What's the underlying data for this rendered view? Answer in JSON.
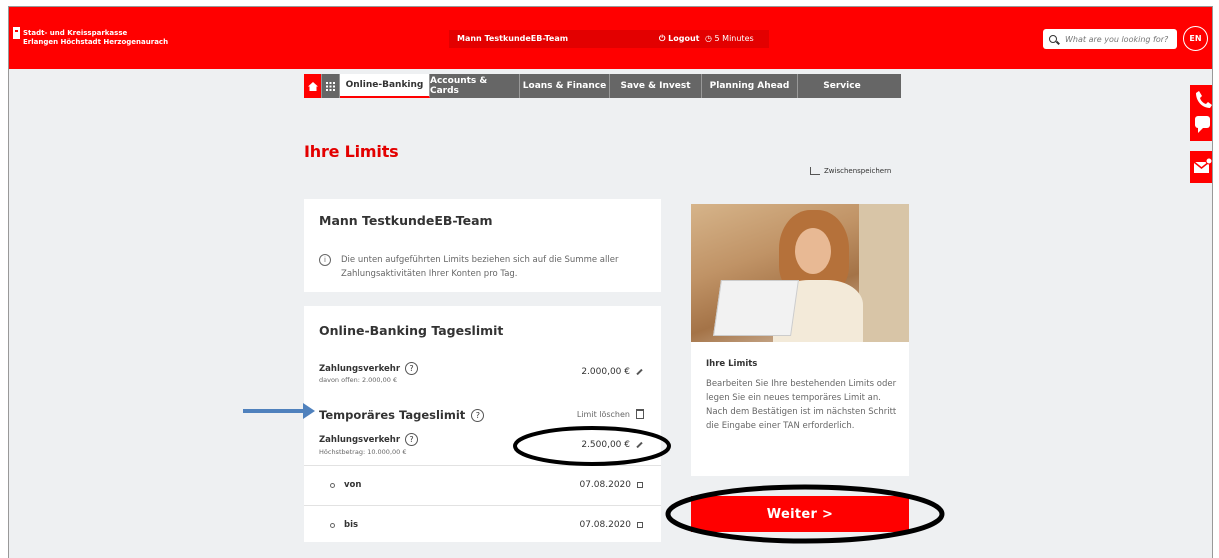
{
  "bank": {
    "name_line1": "Stadt- und Kreissparkasse",
    "name_line2": "Erlangen Höchstadt Herzogenaurach"
  },
  "header": {
    "user_name": "Mann TestkundeEB-Team",
    "logout_label": "Logout",
    "timer_label": "5 Minutes",
    "search_placeholder": "What are you looking for?",
    "language": "EN"
  },
  "nav": {
    "items": [
      {
        "label": "Online-Banking",
        "active": true
      },
      {
        "label": "Accounts & Cards",
        "active": false
      },
      {
        "label": "Loans & Finance",
        "active": false
      },
      {
        "label": "Save & Invest",
        "active": false
      },
      {
        "label": "Planning Ahead",
        "active": false
      },
      {
        "label": "Service",
        "active": false
      }
    ]
  },
  "page": {
    "title": "Ihre Limits",
    "save_draft_label": "Zwischenspeichern"
  },
  "user_card": {
    "name": "Mann TestkundeEB-Team",
    "info_icon": "i",
    "info_text": "Die unten aufgeführten Limits beziehen sich auf die Summe aller Zahlungsaktivitäten Ihrer Konten pro Tag."
  },
  "limit_card": {
    "title": "Online-Banking Tageslimit",
    "payment_label": "Zahlungsverkehr",
    "payment_sub": "davon offen: 2.000,00 €",
    "payment_amount": "2.000,00 €",
    "temp_title": "Temporäres Tageslimit",
    "delete_label": "Limit löschen",
    "temp_payment_label": "Zahlungsverkehr",
    "temp_payment_sub": "Höchstbetrag: 10.000,00 €",
    "temp_payment_amount": "2.500,00 €",
    "help_icon": "?",
    "from_label": "von",
    "from_date": "07.08.2020",
    "to_label": "bis",
    "to_date": "07.08.2020"
  },
  "info_card": {
    "title": "Ihre Limits",
    "text": "Bearbeiten Sie Ihre bestehenden Limits oder legen Sie ein neues temporäres Limit an. Nach dem Bestätigen ist im nächsten Schritt die Eingabe einer TAN erforderlich."
  },
  "actions": {
    "next_label": "Weiter >"
  },
  "colors": {
    "brand_red": "#ff0000",
    "nav_gray": "#666666",
    "annotation_arrow": "#4f81bd"
  }
}
